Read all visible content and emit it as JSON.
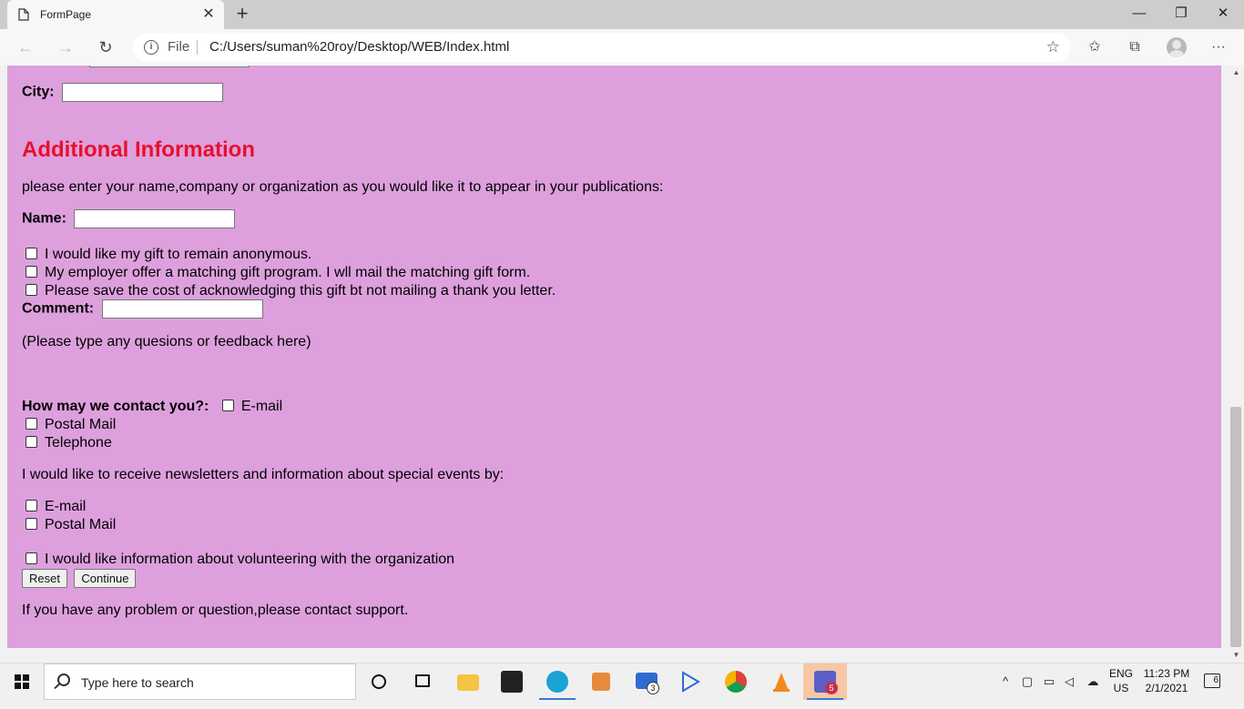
{
  "browser": {
    "tab_title": "FormPage",
    "tab_close": "✕",
    "new_tab": "+",
    "window_controls": {
      "minimize": "—",
      "restore": "❐",
      "close": "✕"
    },
    "nav": {
      "back": "←",
      "forward": "→",
      "refresh": "↻"
    },
    "address": {
      "scheme": "File",
      "url": "C:/Users/suman%20roy/Desktop/WEB/Index.html",
      "info_glyph": "i"
    },
    "toolbar_icons": {
      "favorite": "☆",
      "favorites": "✩",
      "collections": "⧉",
      "menu": "···"
    }
  },
  "form": {
    "city_label": "City:",
    "section_title": "Additional Information",
    "intro": "please enter your name,company or organization as you would like it to appear in your publications:",
    "name_label": "Name:",
    "checks": [
      "I would like my gift to remain anonymous.",
      "My employer offer a matching gift program. I wll mail the matching gift form.",
      "Please save the cost of acknowledging this gift bt not mailing a thank you letter."
    ],
    "comment_label": "Comment:",
    "comment_hint": "(Please type any quesions or feedback here)",
    "contact_label": "How may we contact you?:",
    "contact_options": [
      "E-mail",
      "Postal Mail",
      "Telephone"
    ],
    "newsletter_text": "I would like to receive newsletters and information about special events by:",
    "newsletter_options": [
      "E-mail",
      "Postal Mail"
    ],
    "volunteer_text": "I would like information about volunteering with the organization",
    "reset_label": "Reset",
    "continue_label": "Continue",
    "footer": "If you have any problem or question,please contact support."
  },
  "scrollbar": {
    "up": "▲",
    "down": "▼"
  },
  "taskbar": {
    "search_placeholder": "Type here to search",
    "mail_badge": "3",
    "teams_badge": "5",
    "language": "ENG",
    "region": "US",
    "time": "11:23 PM",
    "date": "2/1/2021",
    "notification_count": "6",
    "tray_up": "^"
  },
  "colors": {
    "page_bg": "#dda0dd",
    "heading": "#e8102b"
  }
}
